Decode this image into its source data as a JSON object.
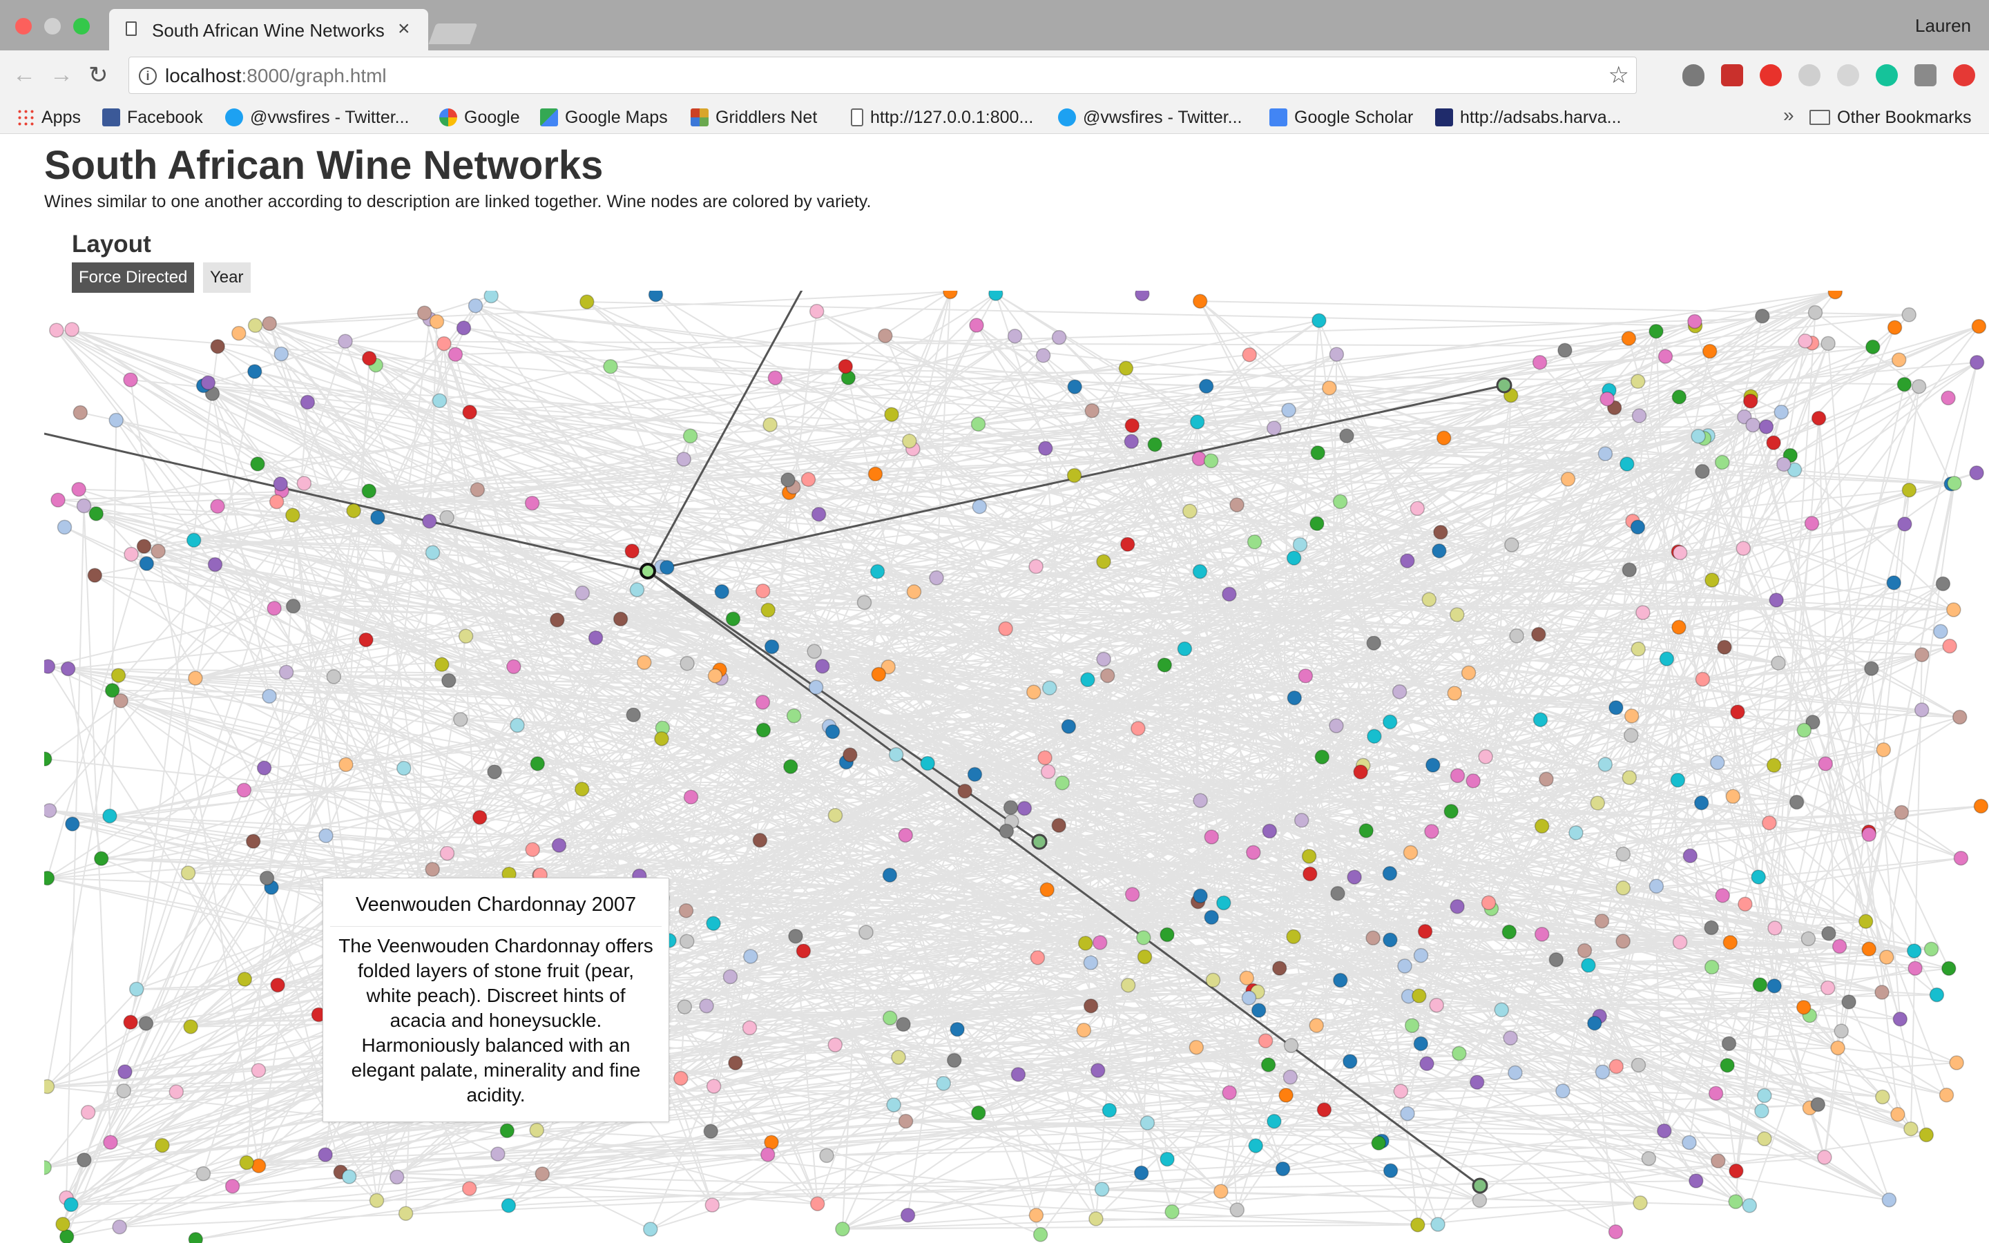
{
  "browser": {
    "tab_title": "South African Wine Networks",
    "tab_close": "×",
    "profile_name": "Lauren",
    "url_host": "localhost",
    "url_path": ":8000/graph.html",
    "nav_back": "←",
    "nav_forward": "→",
    "nav_reload": "↻",
    "info_glyph": "i",
    "star_glyph": "☆",
    "bookmarks": [
      {
        "label": "Apps",
        "icon": "apps-grid-icon",
        "color": "#e94235"
      },
      {
        "label": "Facebook",
        "icon": "facebook-icon",
        "color": "#3b5998"
      },
      {
        "label": "@vwsfires - Twitter...",
        "icon": "twitter-icon",
        "color": "#1da1f2"
      },
      {
        "label": "Google",
        "icon": "google-icon",
        "color": "#4285f4"
      },
      {
        "label": "Google Maps",
        "icon": "google-maps-icon",
        "color": "#34a853"
      },
      {
        "label": "Griddlers Net",
        "icon": "griddlers-icon",
        "color": "#d9a52b"
      },
      {
        "label": "http://127.0.0.1:800...",
        "icon": "page-icon",
        "color": "#ffffff"
      },
      {
        "label": "@vwsfires - Twitter...",
        "icon": "twitter-icon",
        "color": "#1da1f2"
      },
      {
        "label": "Google Scholar",
        "icon": "google-scholar-icon",
        "color": "#4285f4"
      },
      {
        "label": "http://adsabs.harva...",
        "icon": "ads-icon",
        "color": "#1f2b6b"
      }
    ],
    "more_bookmarks_glyph": "»",
    "other_bookmarks": "Other Bookmarks"
  },
  "page": {
    "title": "South African Wine Networks",
    "subtitle": "Wines similar to one another according to description are linked together. Wine nodes are colored by variety.",
    "layout_heading": "Layout",
    "layout_buttons": [
      "Force Directed",
      "Year"
    ],
    "active_layout": "Force Directed"
  },
  "tooltip": {
    "title": "Veenwouden Chardonnay 2007",
    "body": "The Veenwouden Chardonnay offers folded layers of stone fruit (pear, white peach). Discreet hints of acacia and honeysuckle. Harmoniously balanced with an elegant palate, minerality and fine acidity."
  },
  "graph": {
    "node_colors": [
      "#1f77b4",
      "#aec7e8",
      "#ff7f0e",
      "#ffbb78",
      "#2ca02c",
      "#98df8a",
      "#d62728",
      "#ff9896",
      "#9467bd",
      "#c5b0d5",
      "#8c564b",
      "#c49c94",
      "#e377c2",
      "#f7b6d2",
      "#7f7f7f",
      "#c7c7c7",
      "#bcbd22",
      "#dbdb8d",
      "#17becf",
      "#9edae5"
    ],
    "link_color": "#e3e3e3",
    "highlight_link_color": "#555555",
    "selected_node_color": "#98df8a"
  }
}
